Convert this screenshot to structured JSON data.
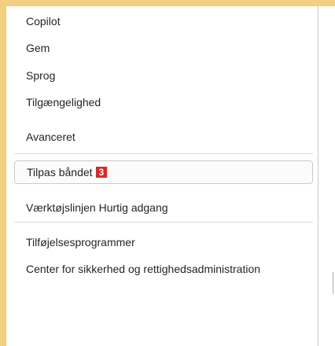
{
  "menu": {
    "items": [
      {
        "label": "Copilot"
      },
      {
        "label": "Gem"
      },
      {
        "label": "Sprog"
      },
      {
        "label": "Tilgængelighed"
      },
      {
        "label": "Avanceret"
      },
      {
        "label": "Tilpas båndet",
        "badge": "3",
        "selected": true
      },
      {
        "label": "Værktøjslinjen Hurtig adgang"
      },
      {
        "label": "Tilføjelsesprogrammer"
      },
      {
        "label": "Center for sikkerhed og rettighedsadministration"
      }
    ]
  },
  "colors": {
    "frame": "#f3cf82",
    "badge": "#d62a2a"
  }
}
